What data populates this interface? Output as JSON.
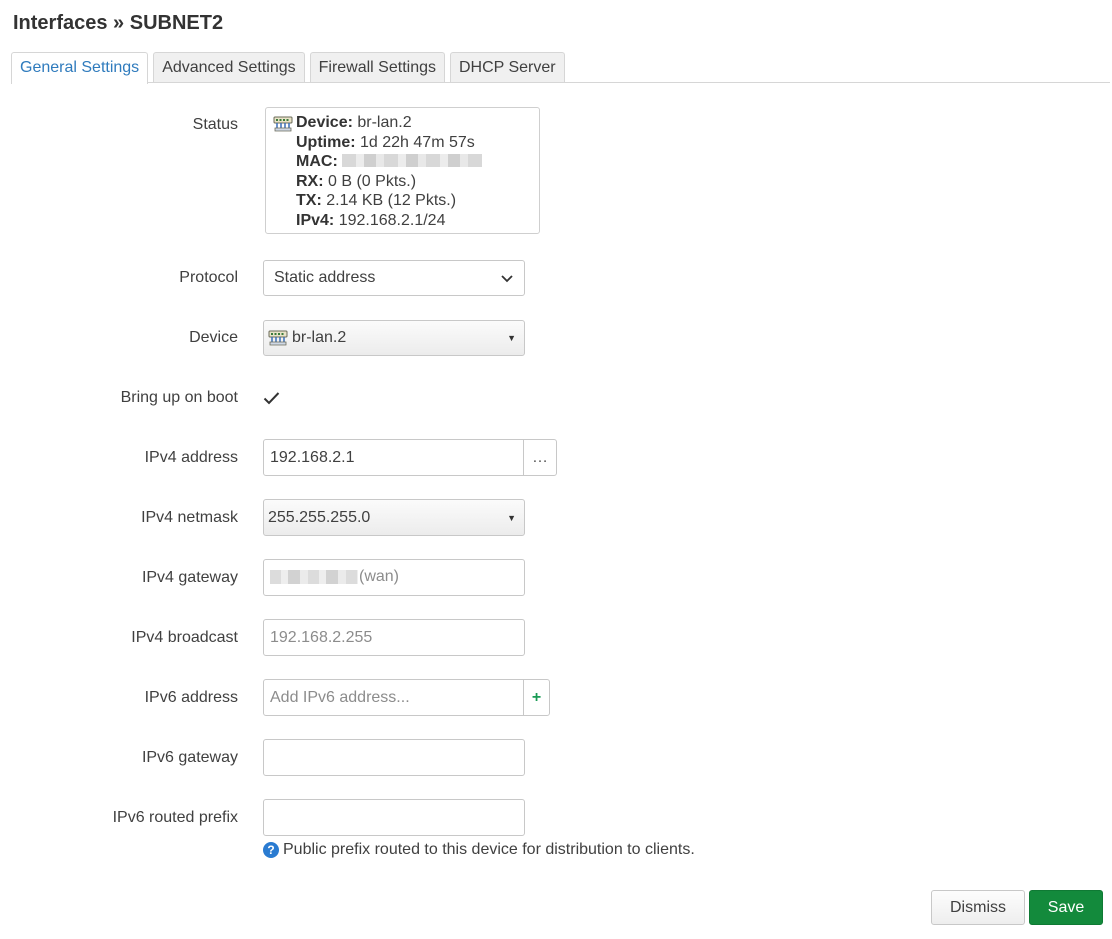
{
  "page": {
    "title": "Interfaces » SUBNET2"
  },
  "tabs": [
    {
      "label": "General Settings",
      "active": true
    },
    {
      "label": "Advanced Settings",
      "active": false
    },
    {
      "label": "Firewall Settings",
      "active": false
    },
    {
      "label": "DHCP Server",
      "active": false
    }
  ],
  "status": {
    "label": "Status",
    "icon": "network-device-icon",
    "device_key": "Device:",
    "device_value": "br-lan.2",
    "uptime_key": "Uptime:",
    "uptime_value": "1d 22h 47m 57s",
    "mac_key": "MAC:",
    "rx_key": "RX:",
    "rx_value": "0 B (0 Pkts.)",
    "tx_key": "TX:",
    "tx_value": "2.14 KB (12 Pkts.)",
    "ipv4_key": "IPv4:",
    "ipv4_value": "192.168.2.1/24"
  },
  "protocol": {
    "label": "Protocol",
    "value": "Static address"
  },
  "device": {
    "label": "Device",
    "value": "br-lan.2"
  },
  "boot": {
    "label": "Bring up on boot",
    "checked": true
  },
  "ipv4_address": {
    "label": "IPv4 address",
    "value": "192.168.2.1",
    "addon": "…"
  },
  "ipv4_netmask": {
    "label": "IPv4 netmask",
    "value": "255.255.255.0"
  },
  "ipv4_gateway": {
    "label": "IPv4 gateway",
    "placeholder_suffix": "(wan)"
  },
  "ipv4_broadcast": {
    "label": "IPv4 broadcast",
    "placeholder": "192.168.2.255"
  },
  "ipv6_address": {
    "label": "IPv6 address",
    "placeholder": "Add IPv6 address...",
    "addon": "+"
  },
  "ipv6_gateway": {
    "label": "IPv6 gateway",
    "value": ""
  },
  "ipv6_prefix": {
    "label": "IPv6 routed prefix",
    "value": "",
    "hint": "Public prefix routed to this device for distribution to clients."
  },
  "actions": {
    "dismiss": "Dismiss",
    "save": "Save"
  },
  "colors": {
    "accent": "#2f7bbd",
    "save": "#138a3c",
    "help": "#2a7bd1"
  }
}
